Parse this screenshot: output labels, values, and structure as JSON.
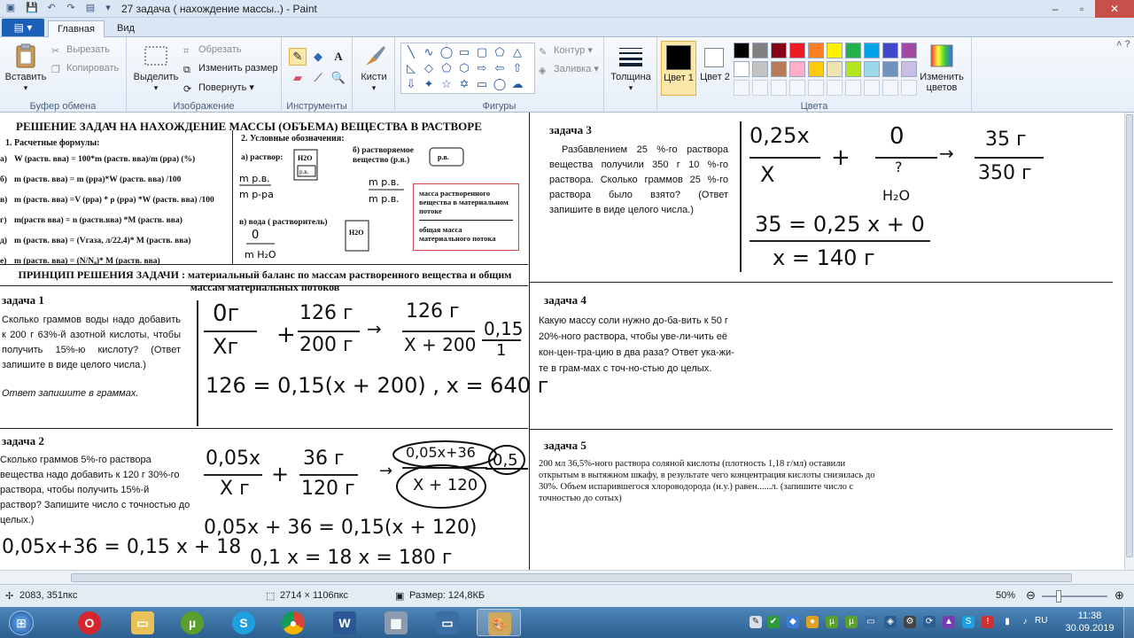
{
  "window": {
    "title": "27 задача ( нахождение массы..) - Paint",
    "controls": {
      "minimize": "–",
      "maximize": "▫",
      "close": "✕"
    }
  },
  "tabs": {
    "menu": "▤ ▾",
    "home": "Главная",
    "view": "Вид"
  },
  "ribbon": {
    "clipboard": {
      "label": "Буфер обмена",
      "paste": "Вставить",
      "cut": "Вырезать",
      "copy": "Копировать"
    },
    "image": {
      "label": "Изображение",
      "select": "Выделить",
      "crop": "Обрезать",
      "resize": "Изменить размер",
      "rotate": "Повернуть"
    },
    "tools": {
      "label": "Инструменты"
    },
    "brushes": "Кисти",
    "shapes": {
      "label": "Фигуры",
      "outline": "Контур",
      "fill": "Заливка"
    },
    "size": "Толщина",
    "color1": "Цвет 1",
    "color2": "Цвет 2",
    "colors_label": "Цвета",
    "edit_colors": "Изменить цветов",
    "palette": [
      "#000000",
      "#7f7f7f",
      "#880015",
      "#ed1c24",
      "#ff7f27",
      "#fff200",
      "#22b14c",
      "#00a2e8",
      "#3f48cc",
      "#a349a4",
      "#ffffff",
      "#c3c3c3",
      "#b97a57",
      "#ffaec9",
      "#ffc90e",
      "#efe4b0",
      "#b5e61d",
      "#99d9ea",
      "#7092be",
      "#c8bfe7"
    ]
  },
  "doc": {
    "heading": "РЕШЕНИЕ ЗАДАЧ НА НАХОЖДЕНИЕ МАССЫ (ОБЪЕМА) ВЕЩЕСТВА В РАСТВОРЕ",
    "formulas_title": "1. Расчетные формулы:",
    "formulas": [
      "W (раств. вва) = 100*m (раств. вва)/m (рра)  (%)",
      "m (раств. вва) = m (рра)*W (раств. вва) /100",
      "m (раств. вва) =V (рра) * ρ (рра)  *W (раств. вва) /100",
      "m(раств вва) = n (раств.вва) *M (раств. вва)",
      "m  (раств. вва) = (Vгаза, л/22,4)* M (раств. вва)",
      "m (раств. вва) = (N/Nₐ)* M (раств. вва)"
    ],
    "formula_letters": [
      "а)",
      "б)",
      "в)",
      "г)",
      "д)",
      "е)"
    ],
    "notation_title": "2. Условные обозначения:",
    "notation_a": "а) раствор:",
    "notation_b": "б) растворяемое вещество (р.в.)",
    "notation_c": "в) вода ( растворитель)",
    "box_top": "масса растворенного вещества в материальном потоке",
    "box_bottom": "общая масса материального потока",
    "principle": "ПРИНЦИП РЕШЕНИЯ ЗАДАЧИ : материальный баланс по массам растворенного вещества и общим массам материальных потоков",
    "t1_title": "задача 1",
    "t1_text": "Сколько граммов воды надо добавить к 200 г 63%-й азотной кислоты, чтобы получить 15%-ю кислоту? (Ответ запишите в виде целого числа.)",
    "t1_note": "Ответ запишите в граммах.",
    "t2_title": "задача 2",
    "t2_text": "Сколько граммов 5%-го раствора вещества надо добавить к 120 г 30%-го раствора, чтобы получить 15%-й раствор? Запишите число с точностью до целых.)",
    "t3_title": "задача 3",
    "t3_text": "Разбавлением 25 %-го раствора вещества получили 350 г 10 %-го раствора. Сколько граммов 25 %-го раствора было взято? (Ответ запишите в виде целого числа.)",
    "t4_title": "задача 4",
    "t4_text": "Какую массу соли нужно до-ба-вить к 50 г 20%-ного раствора, чтобы уве-ли-чить её кон-цен-тра-цию в два раза? Ответ ука-жи-те в грам-мах с точ-но-стью до целых.",
    "t5_title": "задача 5",
    "t5_text": "200 мл 36,5%-ного раствора соляной кислоты (плотность 1,18 г/мл) оставили открытым в вытяжном шкафу, в результате чего концентрация кислоты снизилась до 30%. Объем испарившегося хлороводорода (н.у.) равен......л. (запишите число с точностью до сотых)"
  },
  "handwriting": {
    "t1_f1": "0г",
    "t1_f1d": "Хг",
    "t1_f2": "126 г",
    "t1_f2d": "200 г",
    "t1_f3": "126 г",
    "t1_f3d": "Х + 200",
    "t1_f4": "0,15",
    "t1_f4d": "1",
    "t1_eq": "126 = 0,15(х + 200) , х = 640 г",
    "t2_f1": "0,05х",
    "t2_f1d": "Х г",
    "t2_f2": "36 г",
    "t2_f2d": "120 г",
    "t2_f3": "0,05х+36",
    "t2_f3d": "Х + 120",
    "t2_f4": "0,5",
    "t2_eq1": "0,05х + 36 = 0,15(х + 120)",
    "t2_eq2": "0,1 х = 18   х = 180 г",
    "t2_eq3": "0,05х+36 = 0,15 х  + 18",
    "t3_f1": "0,25х",
    "t3_f1d": "Х",
    "t3_f2": "0",
    "t3_f2d": "?",
    "t3_f2n": "H₂O",
    "t3_f3": "35 г",
    "t3_f3d": "350 г",
    "t3_eq1": "35 = 0,25 х + 0",
    "t3_eq2": "х = 140 г"
  },
  "status": {
    "cursor": "2083, 351пкс",
    "dims": "2714 × 1106пкс",
    "size": "Размер: 124,8КБ",
    "zoom": "50%"
  },
  "taskbar": {
    "time": "11:38",
    "date": "30.09.2019",
    "lang": "RU"
  }
}
